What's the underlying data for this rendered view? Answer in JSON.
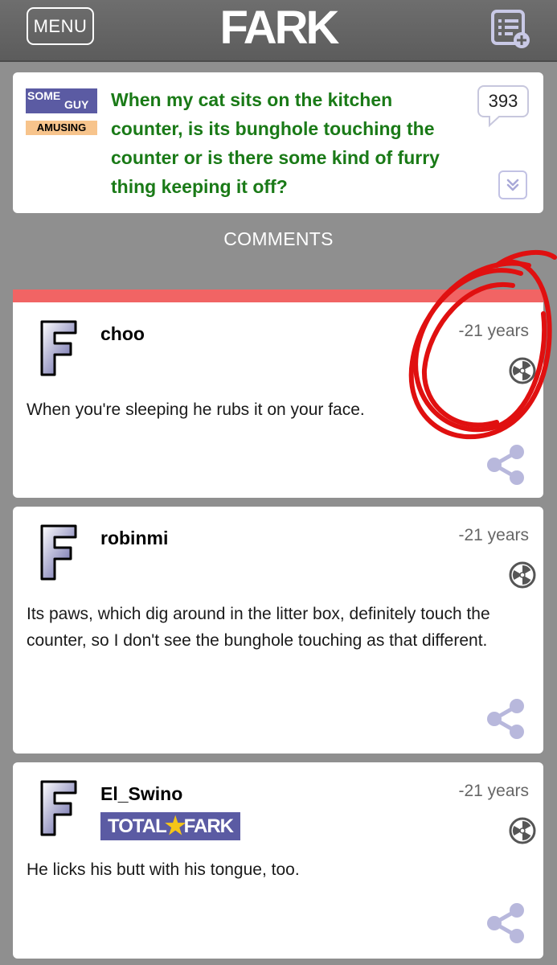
{
  "header": {
    "menu_label": "MENU",
    "logo": "FARK"
  },
  "headline": {
    "source_top": "SOME",
    "source_bottom": "GUY",
    "tag": "AMUSING",
    "text": "When my cat sits on the kitchen counter, is its bunghole touching the counter or is there some kind of furry thing keeping it off?",
    "comment_count": "393"
  },
  "comments_heading": "COMMENTS",
  "comments": [
    {
      "username": "choo",
      "time": "-21 years",
      "text": "When you're sleeping he rubs it on your face."
    },
    {
      "username": "robinmi",
      "time": "-21 years",
      "text": "Its paws, which dig around in the litter box, definitely touch the counter, so I don't see the bunghole touching as that different."
    },
    {
      "username": "El_Swino",
      "time": "-21 years",
      "badge_left": "TOTAL",
      "badge_right": "FARK",
      "text": "He licks his butt with his tongue, too."
    }
  ],
  "colors": {
    "headline_green": "#1a7a17",
    "accent_bar": "#f16464",
    "badge_purple": "#5b5ba3",
    "icon_lavender": "#b8b8dc",
    "annotation_red": "#e01010"
  }
}
